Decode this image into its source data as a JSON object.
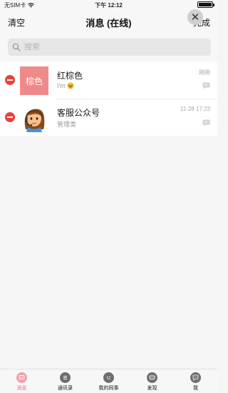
{
  "status_bar": {
    "carrier": "无SIM卡",
    "time": "下午 12:12"
  },
  "nav": {
    "left": "清空",
    "title": "消息 (在线)",
    "right": "完成",
    "close_glyph": "✕"
  },
  "search": {
    "placeholder": "搜索"
  },
  "conversations": [
    {
      "avatar_text": "棕色",
      "avatar_color": "#f08a8a",
      "title": "红棕色",
      "subtitle": "I'm",
      "subtitle_icon": "grinning-emoji-icon",
      "time": "刚刚"
    },
    {
      "avatar_icon": "customer-service-avatar",
      "title": "客服公众号",
      "subtitle": "管理类",
      "time": "11-28 17:23"
    }
  ],
  "tabs": [
    {
      "label": "消息",
      "icon": "message-icon",
      "active": true
    },
    {
      "label": "通讯录",
      "icon": "contacts-icon",
      "active": false
    },
    {
      "label": "我的同事",
      "icon": "colleagues-icon",
      "active": false
    },
    {
      "label": "发现",
      "icon": "discover-icon",
      "active": false
    },
    {
      "label": "我",
      "icon": "me-icon",
      "active": false
    }
  ],
  "colors": {
    "accent": "#e86f7a",
    "delete": "#e8423f"
  }
}
